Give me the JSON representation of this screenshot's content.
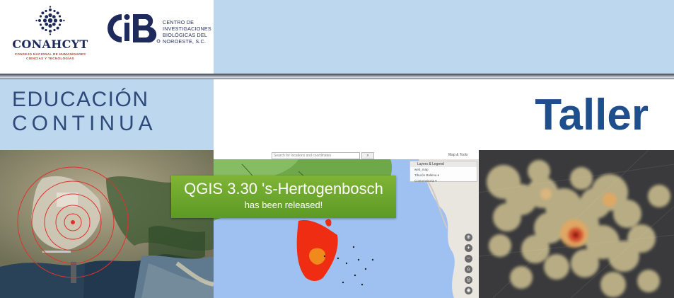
{
  "header": {
    "conahcyt": {
      "name": "CONAHCYT",
      "subtitle": "CONSEJO NACIONAL DE HUMANIDADES CIENCIAS Y TECNOLOGÍAS"
    },
    "cibnor": {
      "monogram": "CIB",
      "lines": [
        "CENTRO DE",
        "INVESTIGACIONES",
        "BIOLÓGICAS DEL",
        "NOROESTE, S.C."
      ]
    }
  },
  "title_band": {
    "line1": "EDUCACIÓN",
    "line2": "CONTINUA",
    "headline": "Taller"
  },
  "qgis_screenshot": {
    "banner_title": "QGIS 3.30 's-Hertogenbosch",
    "banner_subtitle": "has been released!",
    "search_placeholder": "Search for locations and coordinates",
    "search_button": "⌕",
    "map_tools": "Map & Tools",
    "layers_title": "Layers & Legend",
    "layers_rows": [
      "web_map",
      "Tiburón Ballena ▾",
      "Contornsitoria ▾"
    ],
    "zoom_buttons": [
      "⊕",
      "+",
      "−",
      "⌂",
      "◎",
      "◉"
    ]
  },
  "colors": {
    "light_blue": "#bdd7ee",
    "title_blue": "#2e4a7a",
    "headline_blue": "#1f4e8c",
    "banner_green": "#6aa52c"
  }
}
